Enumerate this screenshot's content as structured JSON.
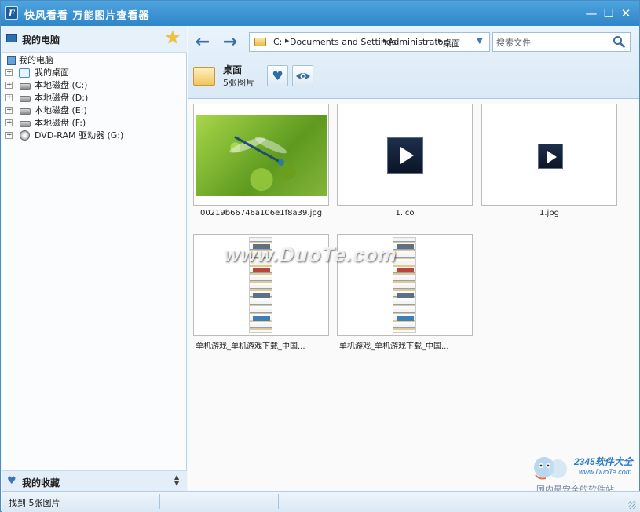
{
  "window": {
    "title": "快风看看  万能图片查看器",
    "logo_letter": "F",
    "controls": {
      "minimize": "—",
      "maximize": "☐",
      "close": "✕"
    }
  },
  "sidebar": {
    "header_title": "我的电脑",
    "tree": [
      {
        "label": "我的电脑",
        "icon": "computer-icon",
        "expandable": false
      },
      {
        "label": "我的桌面",
        "icon": "desktop-icon",
        "expandable": true
      },
      {
        "label": "本地磁盘 (C:)",
        "icon": "drive-icon",
        "expandable": true
      },
      {
        "label": "本地磁盘 (D:)",
        "icon": "drive-icon",
        "expandable": true
      },
      {
        "label": "本地磁盘 (E:)",
        "icon": "drive-icon",
        "expandable": true
      },
      {
        "label": "本地磁盘 (F:)",
        "icon": "drive-icon",
        "expandable": true
      },
      {
        "label": "DVD-RAM 驱动器 (G:)",
        "icon": "disc-icon",
        "expandable": true
      }
    ],
    "footer_title": "我的收藏"
  },
  "toolbar": {
    "path": [
      "C:",
      "Documents and Settings",
      "Administrator",
      "桌面"
    ],
    "search_placeholder": "搜索文件",
    "folder_name": "桌面",
    "folder_count": "5张图片",
    "actions": [
      "heart-icon",
      "eye-icon"
    ]
  },
  "files": [
    {
      "name": "00219b66746a106e1f8a39.jpg",
      "kind": "photo"
    },
    {
      "name": "1.ico",
      "kind": "icon-large"
    },
    {
      "name": "1.jpg",
      "kind": "icon-small"
    },
    {
      "name": "单机游戏_单机游戏下载_中国...",
      "kind": "site"
    },
    {
      "name": "单机游戏_单机游戏下载_中国...",
      "kind": "site"
    }
  ],
  "watermark": "www.DuoTe.com",
  "corner_logo": {
    "brand": "2345软件大全",
    "url": "www.DuoTe.com",
    "slogan": "国内最安全的软件站"
  },
  "status": {
    "text": "找到 5张图片"
  },
  "colors": {
    "titlebar": "#3b93d4",
    "accent": "#2f6ea8",
    "star": "#f2c13c"
  }
}
